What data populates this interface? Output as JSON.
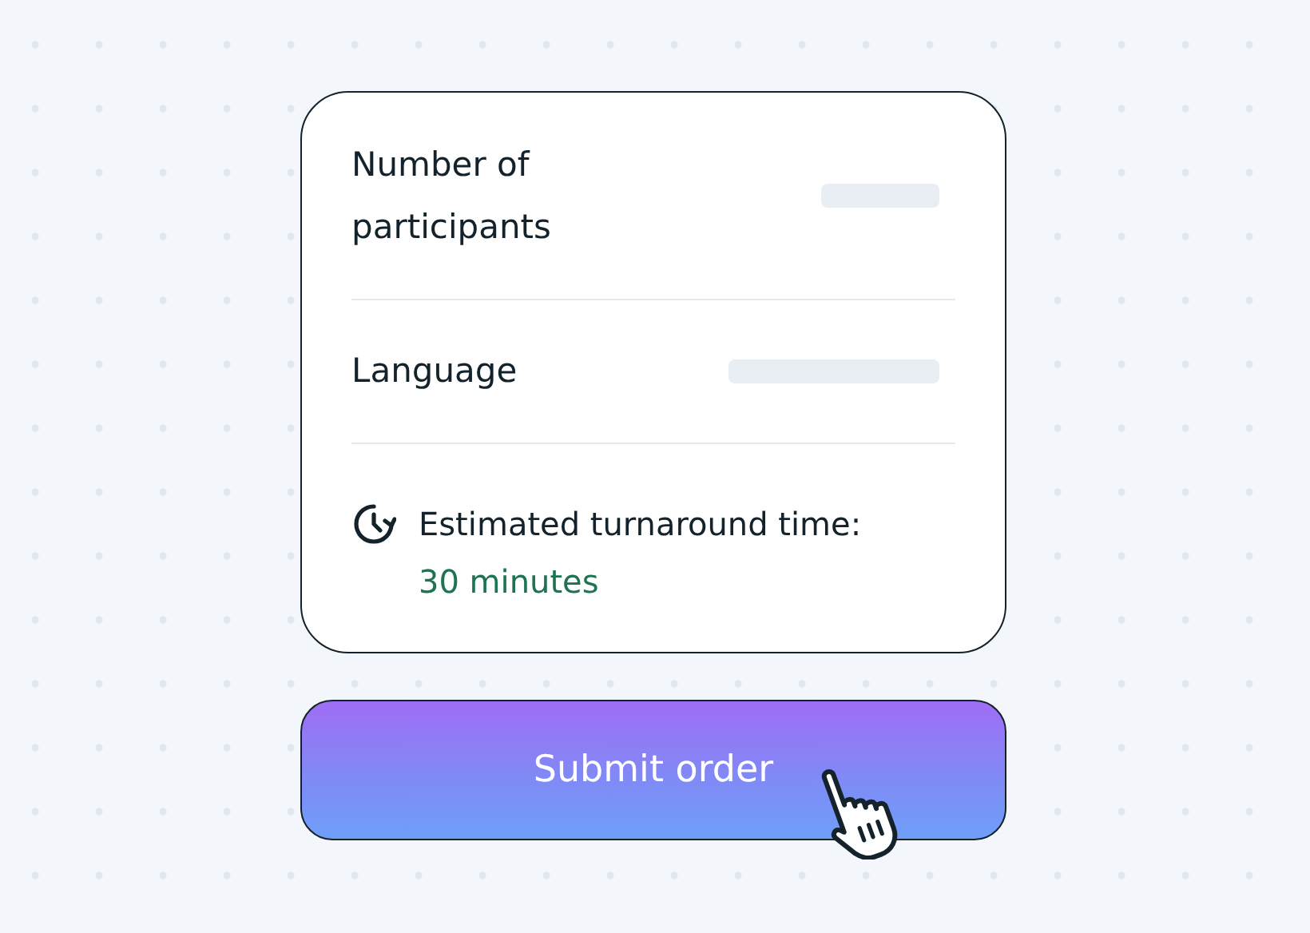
{
  "details": [
    {
      "label": "Number of participants"
    },
    {
      "label": "Language"
    }
  ],
  "estimate": {
    "label": "Estimated turnaround time:",
    "value": "30 minutes"
  },
  "submit_button": {
    "label": "Submit order"
  }
}
